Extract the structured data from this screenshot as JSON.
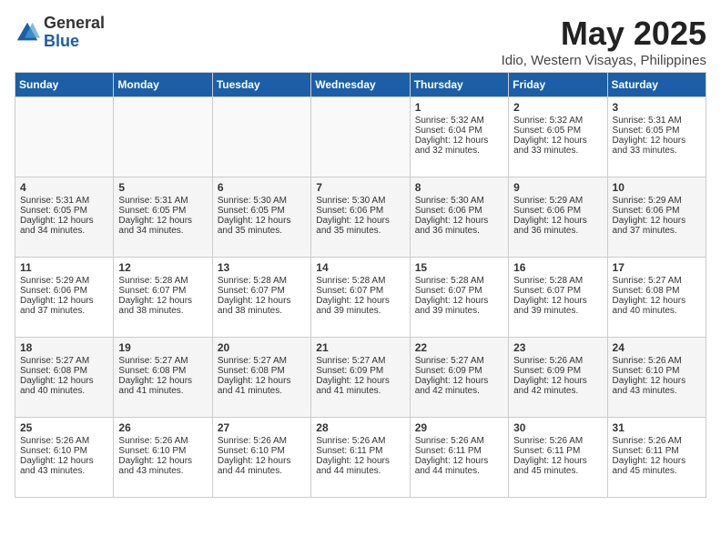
{
  "logo": {
    "general": "General",
    "blue": "Blue"
  },
  "title": "May 2025",
  "location": "Idio, Western Visayas, Philippines",
  "weekdays": [
    "Sunday",
    "Monday",
    "Tuesday",
    "Wednesday",
    "Thursday",
    "Friday",
    "Saturday"
  ],
  "weeks": [
    [
      {
        "day": "",
        "info": ""
      },
      {
        "day": "",
        "info": ""
      },
      {
        "day": "",
        "info": ""
      },
      {
        "day": "",
        "info": ""
      },
      {
        "day": "1",
        "info": "Sunrise: 5:32 AM\nSunset: 6:04 PM\nDaylight: 12 hours\nand 32 minutes."
      },
      {
        "day": "2",
        "info": "Sunrise: 5:32 AM\nSunset: 6:05 PM\nDaylight: 12 hours\nand 33 minutes."
      },
      {
        "day": "3",
        "info": "Sunrise: 5:31 AM\nSunset: 6:05 PM\nDaylight: 12 hours\nand 33 minutes."
      }
    ],
    [
      {
        "day": "4",
        "info": "Sunrise: 5:31 AM\nSunset: 6:05 PM\nDaylight: 12 hours\nand 34 minutes."
      },
      {
        "day": "5",
        "info": "Sunrise: 5:31 AM\nSunset: 6:05 PM\nDaylight: 12 hours\nand 34 minutes."
      },
      {
        "day": "6",
        "info": "Sunrise: 5:30 AM\nSunset: 6:05 PM\nDaylight: 12 hours\nand 35 minutes."
      },
      {
        "day": "7",
        "info": "Sunrise: 5:30 AM\nSunset: 6:06 PM\nDaylight: 12 hours\nand 35 minutes."
      },
      {
        "day": "8",
        "info": "Sunrise: 5:30 AM\nSunset: 6:06 PM\nDaylight: 12 hours\nand 36 minutes."
      },
      {
        "day": "9",
        "info": "Sunrise: 5:29 AM\nSunset: 6:06 PM\nDaylight: 12 hours\nand 36 minutes."
      },
      {
        "day": "10",
        "info": "Sunrise: 5:29 AM\nSunset: 6:06 PM\nDaylight: 12 hours\nand 37 minutes."
      }
    ],
    [
      {
        "day": "11",
        "info": "Sunrise: 5:29 AM\nSunset: 6:06 PM\nDaylight: 12 hours\nand 37 minutes."
      },
      {
        "day": "12",
        "info": "Sunrise: 5:28 AM\nSunset: 6:07 PM\nDaylight: 12 hours\nand 38 minutes."
      },
      {
        "day": "13",
        "info": "Sunrise: 5:28 AM\nSunset: 6:07 PM\nDaylight: 12 hours\nand 38 minutes."
      },
      {
        "day": "14",
        "info": "Sunrise: 5:28 AM\nSunset: 6:07 PM\nDaylight: 12 hours\nand 39 minutes."
      },
      {
        "day": "15",
        "info": "Sunrise: 5:28 AM\nSunset: 6:07 PM\nDaylight: 12 hours\nand 39 minutes."
      },
      {
        "day": "16",
        "info": "Sunrise: 5:28 AM\nSunset: 6:07 PM\nDaylight: 12 hours\nand 39 minutes."
      },
      {
        "day": "17",
        "info": "Sunrise: 5:27 AM\nSunset: 6:08 PM\nDaylight: 12 hours\nand 40 minutes."
      }
    ],
    [
      {
        "day": "18",
        "info": "Sunrise: 5:27 AM\nSunset: 6:08 PM\nDaylight: 12 hours\nand 40 minutes."
      },
      {
        "day": "19",
        "info": "Sunrise: 5:27 AM\nSunset: 6:08 PM\nDaylight: 12 hours\nand 41 minutes."
      },
      {
        "day": "20",
        "info": "Sunrise: 5:27 AM\nSunset: 6:08 PM\nDaylight: 12 hours\nand 41 minutes."
      },
      {
        "day": "21",
        "info": "Sunrise: 5:27 AM\nSunset: 6:09 PM\nDaylight: 12 hours\nand 41 minutes."
      },
      {
        "day": "22",
        "info": "Sunrise: 5:27 AM\nSunset: 6:09 PM\nDaylight: 12 hours\nand 42 minutes."
      },
      {
        "day": "23",
        "info": "Sunrise: 5:26 AM\nSunset: 6:09 PM\nDaylight: 12 hours\nand 42 minutes."
      },
      {
        "day": "24",
        "info": "Sunrise: 5:26 AM\nSunset: 6:10 PM\nDaylight: 12 hours\nand 43 minutes."
      }
    ],
    [
      {
        "day": "25",
        "info": "Sunrise: 5:26 AM\nSunset: 6:10 PM\nDaylight: 12 hours\nand 43 minutes."
      },
      {
        "day": "26",
        "info": "Sunrise: 5:26 AM\nSunset: 6:10 PM\nDaylight: 12 hours\nand 43 minutes."
      },
      {
        "day": "27",
        "info": "Sunrise: 5:26 AM\nSunset: 6:10 PM\nDaylight: 12 hours\nand 44 minutes."
      },
      {
        "day": "28",
        "info": "Sunrise: 5:26 AM\nSunset: 6:11 PM\nDaylight: 12 hours\nand 44 minutes."
      },
      {
        "day": "29",
        "info": "Sunrise: 5:26 AM\nSunset: 6:11 PM\nDaylight: 12 hours\nand 44 minutes."
      },
      {
        "day": "30",
        "info": "Sunrise: 5:26 AM\nSunset: 6:11 PM\nDaylight: 12 hours\nand 45 minutes."
      },
      {
        "day": "31",
        "info": "Sunrise: 5:26 AM\nSunset: 6:11 PM\nDaylight: 12 hours\nand 45 minutes."
      }
    ]
  ]
}
